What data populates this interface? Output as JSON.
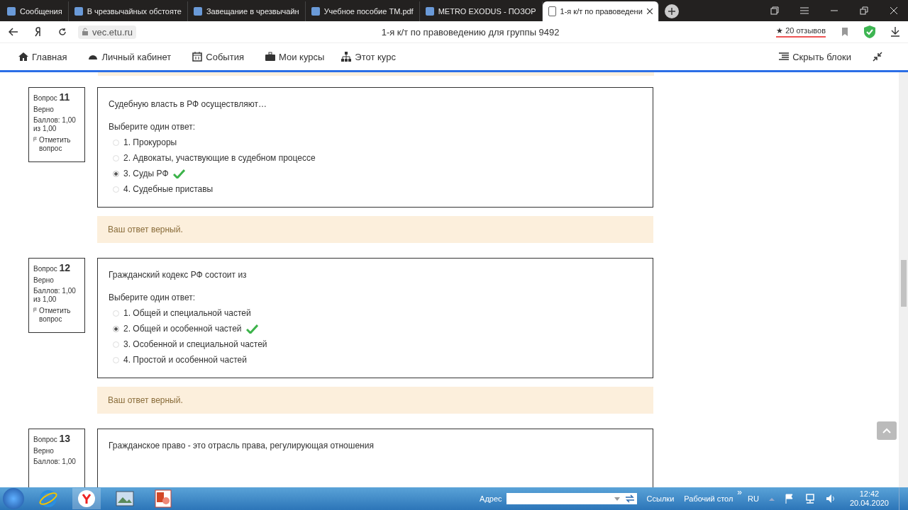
{
  "browser": {
    "tabs": [
      {
        "title": "Сообщения",
        "selected": false
      },
      {
        "title": "В чрезвычайных обстояте",
        "selected": false
      },
      {
        "title": "Завещание в чрезвычайн",
        "selected": false
      },
      {
        "title": "Учебное пособие TM.pdf",
        "selected": false
      },
      {
        "title": "METRO EXODUS - ПОЗОР",
        "selected": false
      },
      {
        "title": "1-я к/т по правоведени",
        "selected": true
      }
    ],
    "address": "vec.etu.ru",
    "page_title": "1-я к/т по правоведению для группы 9492",
    "reviews_star": "★",
    "reviews": "20 отзывов"
  },
  "nav": {
    "items": [
      {
        "label": "Главная"
      },
      {
        "label": "Личный кабинет"
      },
      {
        "label": "События"
      },
      {
        "label": "Мои курсы"
      },
      {
        "label": "Этот курс"
      }
    ],
    "hide_blocks": "Скрыть блоки"
  },
  "questions": [
    {
      "label": "Вопрос",
      "number": "11",
      "status": "Верно",
      "score": "Баллов: 1,00",
      "score_of": "из 1,00",
      "flag": "Отметить вопрос",
      "text": "Судебную власть в РФ осуществляют…",
      "prompt": "Выберите один ответ:",
      "options": [
        {
          "label": "1. Прокуроры",
          "selected": false,
          "correct": false
        },
        {
          "label": "2. Адвокаты, участвующие в судебном процессе",
          "selected": false,
          "correct": false
        },
        {
          "label": "3. Суды РФ",
          "selected": true,
          "correct": true
        },
        {
          "label": "4. Судебные приставы",
          "selected": false,
          "correct": false
        }
      ],
      "feedback": "Ваш ответ верный."
    },
    {
      "label": "Вопрос",
      "number": "12",
      "status": "Верно",
      "score": "Баллов: 1,00",
      "score_of": "из 1,00",
      "flag": "Отметить вопрос",
      "text": "Гражданский кодекс РФ состоит из",
      "prompt": "Выберите один ответ:",
      "options": [
        {
          "label": "1. Общей и специальной частей",
          "selected": false,
          "correct": false
        },
        {
          "label": "2. Общей и особенной частей",
          "selected": true,
          "correct": true
        },
        {
          "label": "3. Особенной и специальной частей",
          "selected": false,
          "correct": false
        },
        {
          "label": "4. Простой и особенной частей",
          "selected": false,
          "correct": false
        }
      ],
      "feedback": "Ваш ответ верный."
    },
    {
      "label": "Вопрос",
      "number": "13",
      "status": "Верно",
      "score": "Баллов: 1,00",
      "text": "Гражданское право - это отрасль права, регулирующая отношения"
    }
  ],
  "taskbar": {
    "address_label": "Адрес",
    "links": "Ссылки",
    "desktop": "Рабочий стол",
    "more": "»",
    "lang": "RU",
    "time": "12:42",
    "date": "20.04.2020"
  }
}
